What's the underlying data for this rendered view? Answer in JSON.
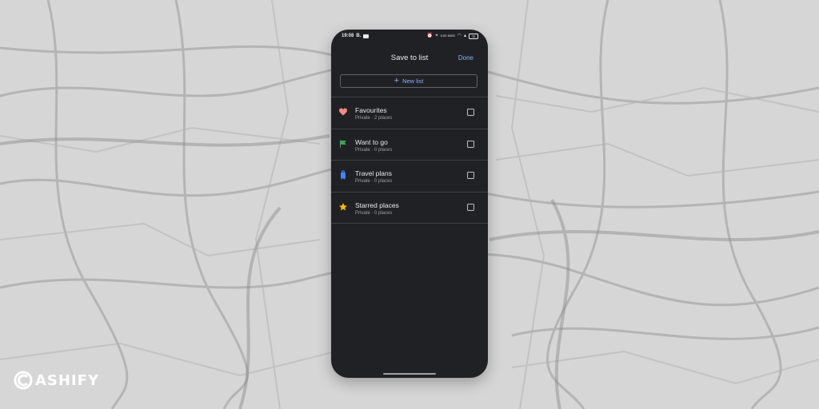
{
  "status_bar": {
    "time": "19:08",
    "app_letter": "B.",
    "speed": "0.00 KB/S",
    "battery": "70",
    "icons": [
      "alarm-icon",
      "location-icon",
      "wifi-icon",
      "signal-icon",
      "battery-icon"
    ]
  },
  "header": {
    "title": "Save to list",
    "done_label": "Done"
  },
  "new_list": {
    "label": "New list",
    "icon": "plus-icon"
  },
  "lists": [
    {
      "title": "Favourites",
      "meta": "Private · 2 places",
      "icon": "heart-icon",
      "color": "#f28b82",
      "checked": false
    },
    {
      "title": "Want to go",
      "meta": "Private · 0 places",
      "icon": "flag-icon",
      "color": "#34a853",
      "checked": false
    },
    {
      "title": "Travel plans",
      "meta": "Private · 0 places",
      "icon": "suitcase-icon",
      "color": "#4285f4",
      "checked": false
    },
    {
      "title": "Starred places",
      "meta": "Private · 0 places",
      "icon": "star-icon",
      "color": "#fbbc04",
      "checked": false
    }
  ],
  "watermark": {
    "text": "ASHIFY"
  },
  "colors": {
    "accent": "#8ab4f8",
    "background": "#202124",
    "divider": "#3c4043"
  }
}
